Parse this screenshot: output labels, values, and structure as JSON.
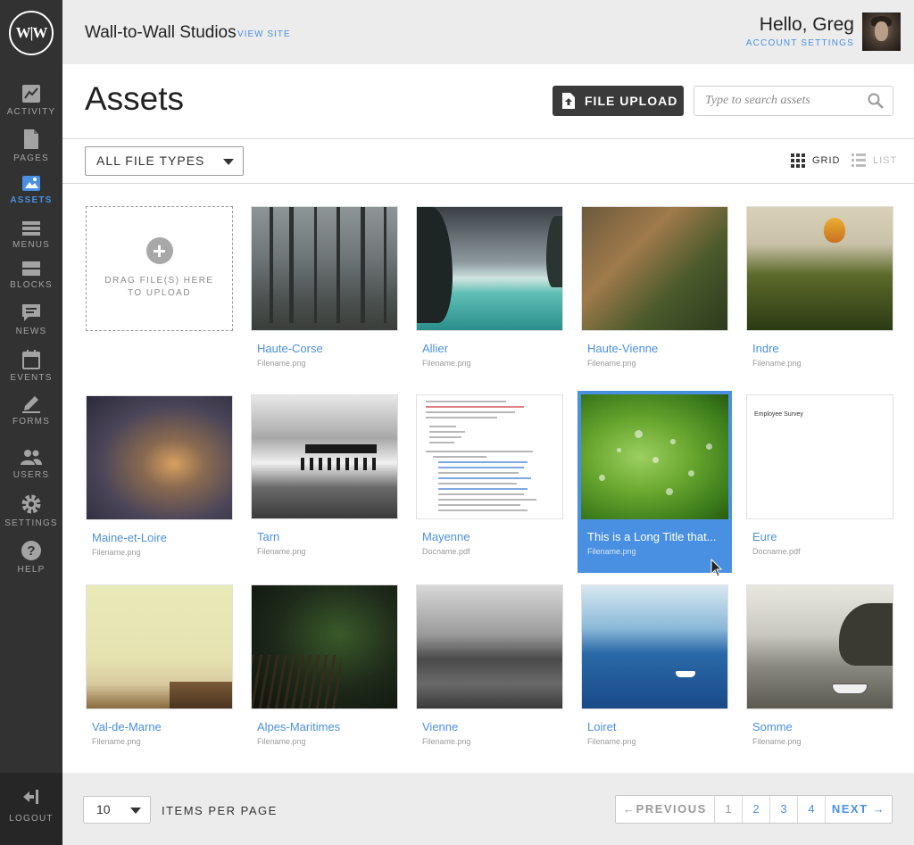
{
  "sidebar": {
    "logo": "W|W",
    "items": [
      {
        "label": "ACTIVITY",
        "icon": "activity-chart-icon"
      },
      {
        "label": "PAGES",
        "icon": "page-icon"
      },
      {
        "label": "ASSETS",
        "icon": "image-folder-icon",
        "active": true
      },
      {
        "label": "MENUS",
        "icon": "menu-list-icon"
      },
      {
        "label": "BLOCKS",
        "icon": "blocks-icon"
      },
      {
        "label": "NEWS",
        "icon": "speech-bubble-icon"
      },
      {
        "label": "EVENTS",
        "icon": "calendar-icon"
      },
      {
        "label": "FORMS",
        "icon": "pencil-icon"
      },
      {
        "label": "USERS",
        "icon": "users-icon"
      },
      {
        "label": "SETTINGS",
        "icon": "gear-icon"
      },
      {
        "label": "HELP",
        "icon": "question-icon"
      }
    ],
    "logout": "LOGOUT"
  },
  "header": {
    "site_name": "Wall-to-Wall Studios",
    "view_site": "VIEW SITE",
    "greeting": "Hello, Greg",
    "account_settings": "ACCOUNT SETTINGS"
  },
  "page": {
    "title": "Assets",
    "upload_label": "FILE UPLOAD",
    "search_placeholder": "Type to search assets"
  },
  "filter": {
    "file_type": "ALL FILE TYPES",
    "view_grid": "GRID",
    "view_list": "LIST",
    "active_view": "grid"
  },
  "dropzone": {
    "text": "DRAG FILE(S) HERE TO UPLOAD"
  },
  "assets": [
    {
      "title": "Haute-Corse",
      "filename": "Filename.png"
    },
    {
      "title": "Allier",
      "filename": "Filename.png"
    },
    {
      "title": "Haute-Vienne",
      "filename": "Filename.png"
    },
    {
      "title": "Indre",
      "filename": "Filename.png"
    },
    {
      "title": "Maine-et-Loire",
      "filename": "Filename.png"
    },
    {
      "title": "Tarn",
      "filename": "Filename.png"
    },
    {
      "title": "Mayenne",
      "filename": "Docname.pdf"
    },
    {
      "title": "This is a Long Title that...",
      "filename": "Filename.png",
      "selected": true
    },
    {
      "title": "Eure",
      "filename": "Docname.pdf"
    },
    {
      "title": "Val-de-Marne",
      "filename": "Filename.png"
    },
    {
      "title": "Alpes-Maritimes",
      "filename": "Filename.png"
    },
    {
      "title": "Vienne",
      "filename": "Filename.png"
    },
    {
      "title": "Loiret",
      "filename": "Filename.png"
    },
    {
      "title": "Somme",
      "filename": "Filename.png"
    }
  ],
  "survey_doc": {
    "heading": "Employee Survey"
  },
  "footer": {
    "per_page": "10",
    "per_page_label": "ITEMS PER PAGE",
    "prev": "←PREVIOUS",
    "pages": [
      "1",
      "2",
      "3",
      "4"
    ],
    "current_page": "1",
    "next": "NEXT →"
  },
  "colors": {
    "accent": "#4a90e2",
    "sidebar_bg": "#323232",
    "header_bg": "#ececec"
  }
}
